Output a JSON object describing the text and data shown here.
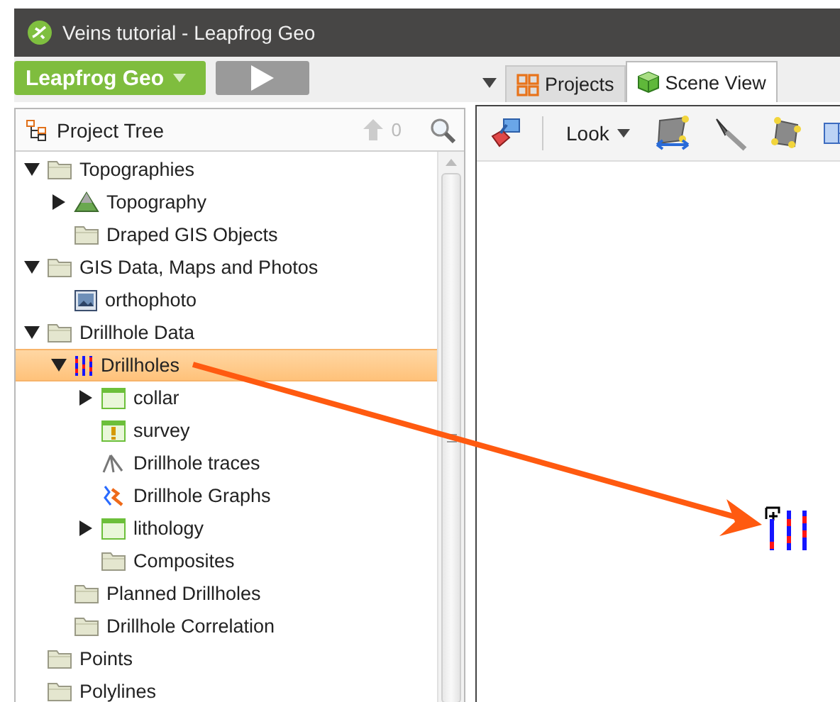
{
  "window": {
    "title": "Veins tutorial - Leapfrog Geo"
  },
  "main_toolbar": {
    "app_menu": "Leapfrog Geo"
  },
  "tabs": [
    {
      "label": "Projects",
      "kind": "projects",
      "selected": false
    },
    {
      "label": "Scene View",
      "kind": "scene",
      "selected": true
    }
  ],
  "project_tree": {
    "title": "Project Tree",
    "count": "0",
    "items": [
      {
        "label": "Topographies",
        "kind": "folder",
        "expanded": true,
        "selected": false,
        "children": [
          {
            "label": "Topography",
            "kind": "topography",
            "expanded": false,
            "selected": false
          },
          {
            "label": "Draped GIS Objects",
            "kind": "folder",
            "selected": false
          }
        ]
      },
      {
        "label": "GIS Data, Maps and Photos",
        "kind": "folder",
        "expanded": true,
        "selected": false,
        "children": [
          {
            "label": "orthophoto",
            "kind": "image",
            "selected": false
          }
        ]
      },
      {
        "label": "Drillhole Data",
        "kind": "folder",
        "expanded": true,
        "selected": false,
        "children": [
          {
            "label": "Drillholes",
            "kind": "drillholes",
            "expanded": true,
            "selected": true,
            "children": [
              {
                "label": "collar",
                "kind": "table",
                "expanded": false,
                "selected": false
              },
              {
                "label": "survey",
                "kind": "survey",
                "selected": false
              },
              {
                "label": "Drillhole traces",
                "kind": "traces",
                "selected": false
              },
              {
                "label": "Drillhole Graphs",
                "kind": "graphs",
                "selected": false
              },
              {
                "label": "lithology",
                "kind": "table",
                "expanded": false,
                "selected": false
              },
              {
                "label": "Composites",
                "kind": "folder",
                "selected": false
              }
            ]
          },
          {
            "label": "Planned Drillholes",
            "kind": "folder",
            "selected": false
          },
          {
            "label": "Drillhole Correlation",
            "kind": "folder",
            "selected": false
          }
        ]
      },
      {
        "label": "Points",
        "kind": "folder",
        "selected": false
      },
      {
        "label": "Polylines",
        "kind": "folder",
        "selected": false
      }
    ]
  },
  "scene_view": {
    "look_label": "Look"
  }
}
